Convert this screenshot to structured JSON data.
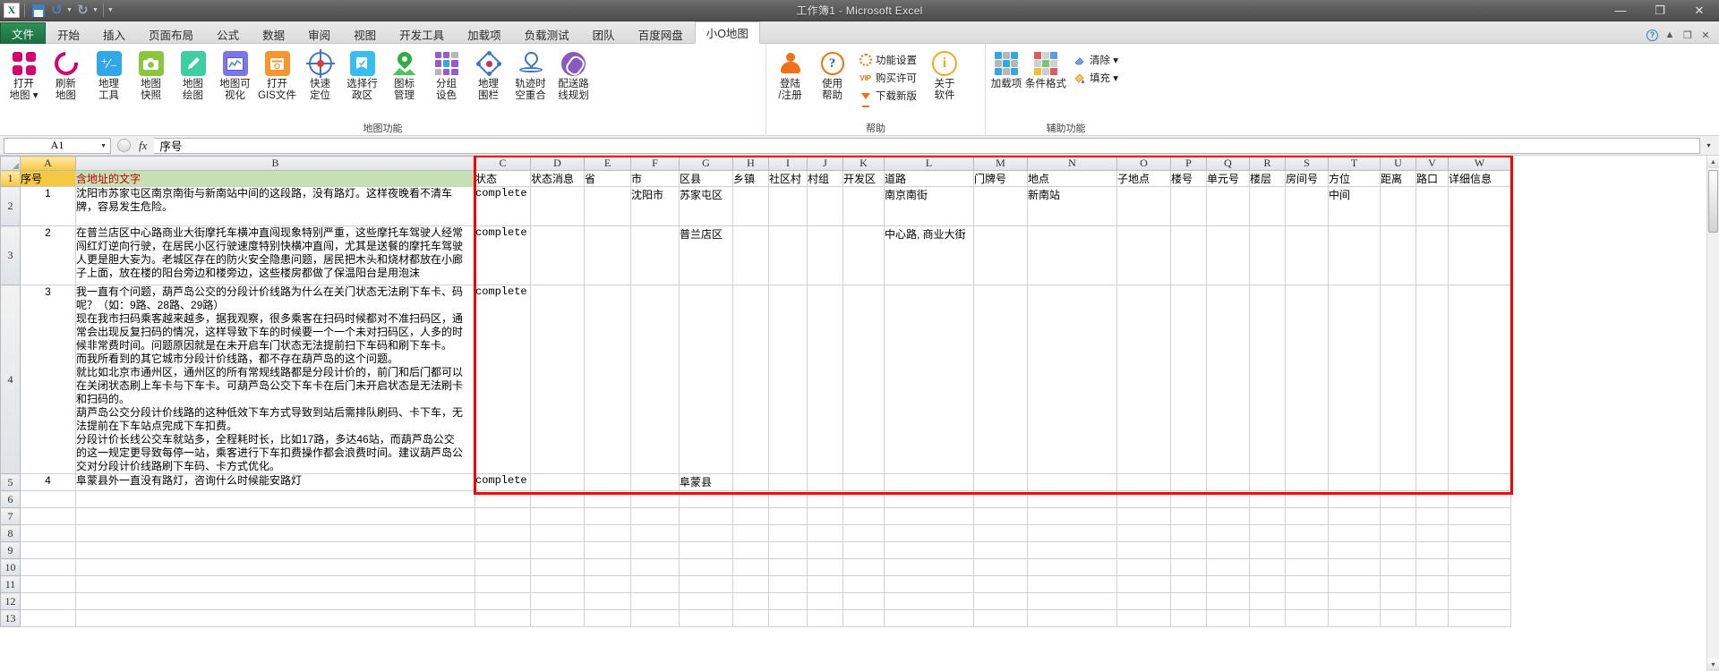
{
  "titlebar": {
    "document_title": "工作簿1 - Microsoft Excel",
    "logo": "X",
    "quick_access": [
      {
        "name": "save",
        "icon": "save-icon"
      },
      {
        "name": "undo",
        "icon": "undo-icon"
      },
      {
        "name": "redo",
        "icon": "redo-icon"
      },
      {
        "name": "customize",
        "icon": "customize-icon"
      }
    ],
    "minimize": "—",
    "restore": "❐",
    "close": "✕"
  },
  "tabs": {
    "file": "文件",
    "items": [
      {
        "label": "开始",
        "active": false
      },
      {
        "label": "插入",
        "active": false
      },
      {
        "label": "页面布局",
        "active": false
      },
      {
        "label": "公式",
        "active": false
      },
      {
        "label": "数据",
        "active": false
      },
      {
        "label": "审阅",
        "active": false
      },
      {
        "label": "视图",
        "active": false
      },
      {
        "label": "开发工具",
        "active": false
      },
      {
        "label": "加载项",
        "active": false
      },
      {
        "label": "负载测试",
        "active": false
      },
      {
        "label": "团队",
        "active": false
      },
      {
        "label": "百度网盘",
        "active": false
      },
      {
        "label": "小O地图",
        "active": true
      }
    ],
    "right_icons": [
      "help-icon",
      "ribbon-minimize-icon",
      "restore-icon",
      "close-icon"
    ]
  },
  "ribbon": {
    "groups": [
      {
        "label": "地图功能",
        "buttons": [
          {
            "name": "open-map",
            "label": "打开\n地图 ▾",
            "icon": "flower-icon"
          },
          {
            "name": "refresh-map",
            "label": "刷新\n地图",
            "icon": "refresh-icon"
          },
          {
            "name": "geo-tools",
            "label": "地理\n工具",
            "icon": "plus-minus-tile-icon"
          },
          {
            "name": "map-snapshot",
            "label": "地图\n快照",
            "icon": "camera-tile-icon"
          },
          {
            "name": "map-draw",
            "label": "地图\n绘图",
            "icon": "pencil-tile-icon"
          },
          {
            "name": "map-visualize",
            "label": "地图可\n视化",
            "icon": "chart-tile-icon"
          },
          {
            "name": "open-gis-file",
            "label": "打开\nGIS文件",
            "icon": "gis-file-tile-icon"
          },
          {
            "name": "quick-locate",
            "label": "快速\n定位",
            "icon": "crosshair-icon"
          },
          {
            "name": "select-district",
            "label": "选择行\n政区",
            "icon": "select-district-tile-icon"
          },
          {
            "name": "icon-manage",
            "label": "图标\n管理",
            "icon": "green-pin-icon"
          },
          {
            "name": "group-color",
            "label": "分组\n设色",
            "icon": "color-grid-icon"
          },
          {
            "name": "geo-fence",
            "label": "地理\n围栏",
            "icon": "diamond-fence-icon"
          },
          {
            "name": "track-overlap",
            "label": "轨迹时\n空重合",
            "icon": "track-pin-icon"
          },
          {
            "name": "route-plan",
            "label": "配送路\n线规划",
            "icon": "route-icon"
          }
        ]
      },
      {
        "label": "帮助",
        "buttons": [
          {
            "name": "login-register",
            "label": "登陆\n/注册",
            "icon": "person-icon"
          },
          {
            "name": "use-help",
            "label": "使用\n帮助",
            "icon": "question-icon"
          },
          {
            "name": "about-software",
            "label": "关于\n软件",
            "icon": "info-icon"
          }
        ],
        "menu": [
          {
            "name": "function-settings",
            "label": "功能设置",
            "icon": "gear-icon"
          },
          {
            "name": "buy-license",
            "label": "购买许可",
            "icon": "vip-icon"
          },
          {
            "name": "download-new",
            "label": "下载新版",
            "icon": "download-icon"
          }
        ]
      },
      {
        "label": "辅助功能",
        "buttons": [
          {
            "name": "addins",
            "label": "加载项",
            "icon": "addins-grid-icon"
          },
          {
            "name": "conditional-format",
            "label": "条件格式",
            "icon": "conditional-format-icon"
          }
        ],
        "menu": [
          {
            "name": "clear",
            "label": "清除 ▾",
            "icon": "eraser-icon"
          },
          {
            "name": "fill",
            "label": "填充 ▾",
            "icon": "fill-icon"
          }
        ]
      }
    ]
  },
  "formula_bar": {
    "name_box": "A1",
    "fx_label": "fx",
    "formula_value": "序号",
    "expand": "▾"
  },
  "sheet": {
    "selected_cell": "A1",
    "left_columns": [
      "A",
      "B"
    ],
    "right_columns": [
      "C",
      "D",
      "E",
      "F",
      "G",
      "H",
      "I",
      "J",
      "K",
      "L",
      "M",
      "N",
      "O",
      "P",
      "Q",
      "R",
      "S",
      "T",
      "U",
      "V",
      "W"
    ],
    "row_numbers": [
      "1",
      "2",
      "3",
      "4",
      "5",
      "6",
      "7",
      "8",
      "9",
      "10",
      "11",
      "12",
      "13"
    ],
    "left_headers": {
      "A": "序号",
      "B": "含地址的文字"
    },
    "right_headers": {
      "C": "状态",
      "D": "状态消息",
      "E": "省",
      "F": "市",
      "G": "区县",
      "H": "乡镇",
      "I": "社区村",
      "J": "村组",
      "K": "开发区",
      "L": "道路",
      "M": "门牌号",
      "N": "地点",
      "O": "子地点",
      "P": "楼号",
      "Q": "单元号",
      "R": "楼层",
      "S": "房间号",
      "T": "方位",
      "U": "距离",
      "V": "路口",
      "W": "详细信息"
    },
    "rows": [
      {
        "row": "2",
        "seq": "1",
        "text": "沈阳市苏家屯区南京南街与新南站中间的这段路，没有路灯。这样夜晚看不清车\n牌，容易发生危险。",
        "status": "complete",
        "city": "沈阳市",
        "district": "苏家屯区",
        "road": "南京南街",
        "place": "新南站",
        "position": "中间"
      },
      {
        "row": "3",
        "seq": "2",
        "text": "在普兰店区中心路商业大街摩托车横冲直闯现象特别严重，这些摩托车驾驶人经常\n闯红灯逆向行驶，在居民小区行驶速度特别快横冲直闯，尤其是送餐的摩托车驾驶\n人更是胆大妄为。老城区存在的防火安全隐患问题，居民把木头和烧材都放在小廊\n子上面，放在楼的阳台旁边和楼旁边，这些楼房都做了保温阳台是用泡沫",
        "status": "complete",
        "district": "普兰店区",
        "road": "中心路, 商业大街"
      },
      {
        "row": "4",
        "seq": "3",
        "text": "我一直有个问题，葫芦岛公交的分段计价线路为什么在关门状态无法刷下车卡、码\n呢？（如：9路、28路、29路）\n现在我市扫码乘客越来越多，据我观察，很多乘客在扫码时候都对不准扫码区，通\n常会出现反复扫码的情况，这样导致下车的时候要一个一个未对扫码区，人多的时\n候非常费时间。问题原因就是在未开启车门状态无法提前扫下车码和刷下车卡。\n而我所看到的其它城市分段计价线路，都不存在葫芦岛的这个问题。\n就比如北京市通州区，通州区的所有常规线路都是分段计价的，前门和后门都可以\n在关闭状态刷上车卡与下车卡。可葫芦岛公交下车卡在后门未开启状态是无法刷卡\n和扫码的。\n葫芦岛公交分段计价线路的这种低效下车方式导致到站后需排队刷码、卡下车，无\n法提前在下车站点完成下车扣费。\n分段计价长线公交车就站多，全程耗时长，比如17路，多达46站，而葫芦岛公交\n的这一规定更导致每停一站，乘客进行下车扣费操作都会浪费时间。建议葫芦岛公\n交对分段计价线路刷下车码、卡方式优化。",
        "status": "complete"
      },
      {
        "row": "5",
        "seq": "4",
        "text": "阜蒙县外一直没有路灯，咨询什么时候能安路灯",
        "status": "complete",
        "district": "阜蒙县"
      }
    ]
  },
  "colors": {
    "header_a": "#f5c842",
    "header_b": "#c6e0b4",
    "header_b_text": "#c00000",
    "selection_box": "#ff0000",
    "excel_green": "#217346"
  }
}
